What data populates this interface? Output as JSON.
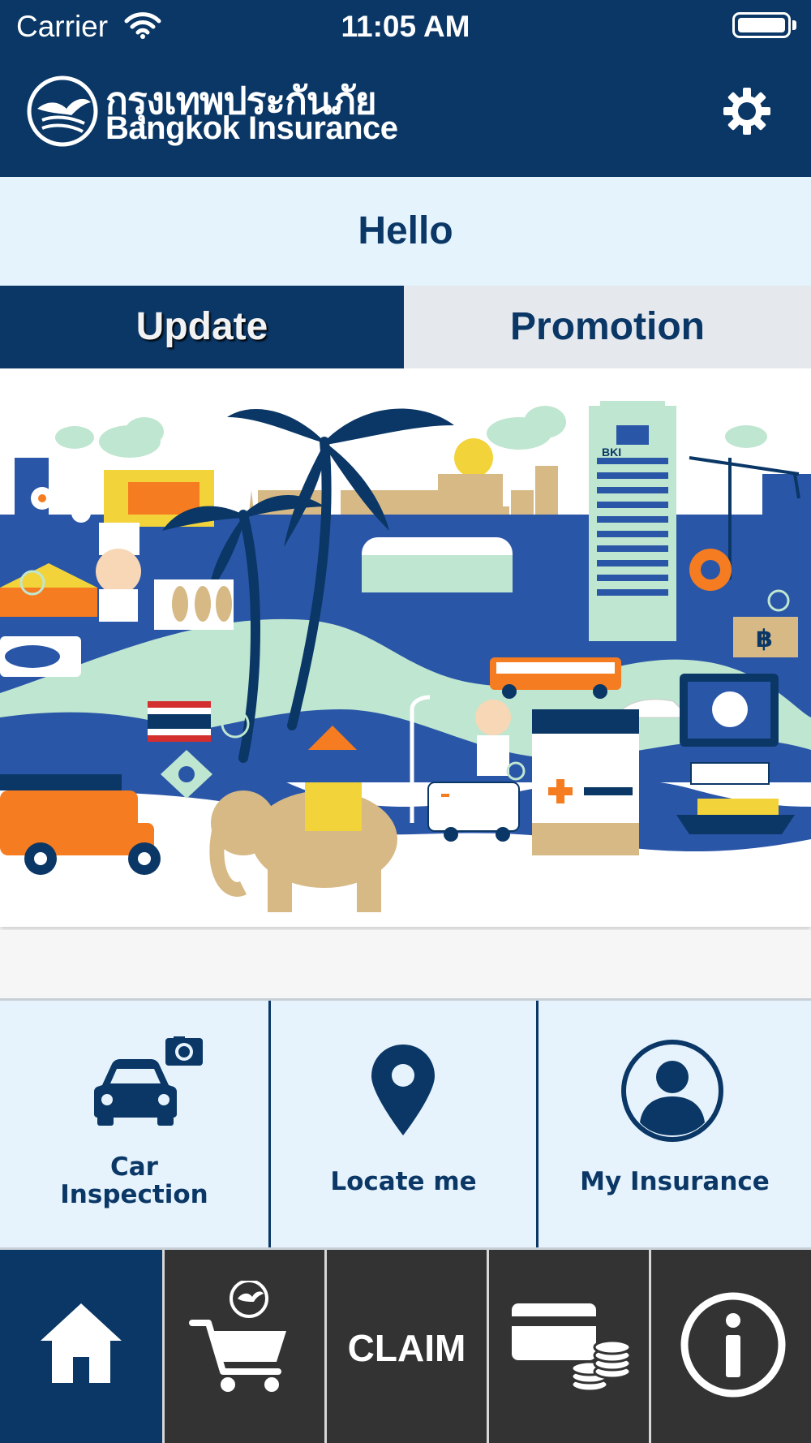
{
  "status_bar": {
    "carrier": "Carrier",
    "time": "11:05 AM"
  },
  "header": {
    "brand_thai": "กรุงเทพประกันภัย",
    "brand_en": "Bangkok Insurance",
    "settings_icon": "gear-icon"
  },
  "greeting": "Hello",
  "tabs": [
    {
      "label": "Update",
      "active": true
    },
    {
      "label": "Promotion",
      "active": false
    }
  ],
  "banner": {
    "sign_text": "BKI",
    "currency_symbol": "฿",
    "colors": {
      "navy": "#0a3766",
      "blue": "#2a56a8",
      "mint": "#bfe6d0",
      "sand": "#d6b985",
      "orange": "#f57c20",
      "yellow": "#f2d33a"
    }
  },
  "quick_actions": [
    {
      "label_line1": "Car",
      "label_line2": "Inspection",
      "icon": "car-camera-icon"
    },
    {
      "label": "Locate me",
      "icon": "location-pin-icon"
    },
    {
      "label": "My Insurance",
      "icon": "user-circle-icon"
    }
  ],
  "bottom_nav": [
    {
      "icon": "home-icon",
      "active": true
    },
    {
      "icon": "shopping-cart-icon",
      "active": false
    },
    {
      "label": "CLAIM",
      "active": false
    },
    {
      "icon": "card-coins-icon",
      "active": false
    },
    {
      "icon": "info-icon",
      "active": false
    }
  ],
  "theme": {
    "primary": "#0a3766",
    "light": "#e4f3fc",
    "nav_dark": "#333333"
  }
}
